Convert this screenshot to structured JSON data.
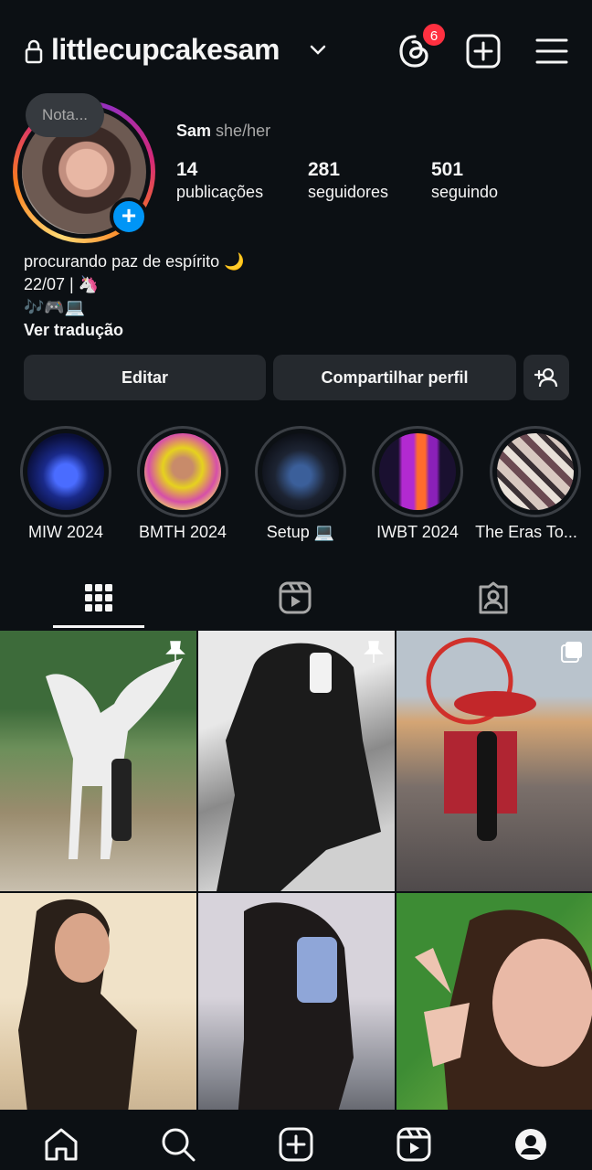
{
  "header": {
    "username": "littlecupcakesam",
    "threads_badge": "6"
  },
  "profile": {
    "note": "Nota...",
    "name": "Sam",
    "pronouns": "she/her",
    "stats": [
      {
        "value": "14",
        "label": "publicações"
      },
      {
        "value": "281",
        "label": "seguidores"
      },
      {
        "value": "501",
        "label": "seguindo"
      }
    ],
    "bio_lines": [
      "procurando paz de espírito 🌙",
      "22/07 | 🦄",
      "🎶🎮💻"
    ],
    "translate": "Ver tradução"
  },
  "buttons": {
    "edit": "Editar",
    "share": "Compartilhar perfil"
  },
  "highlights": [
    {
      "label": "MIW 2024"
    },
    {
      "label": "BMTH 2024"
    },
    {
      "label": "Setup 💻"
    },
    {
      "label": "IWBT 2024"
    },
    {
      "label": "The Eras To..."
    }
  ],
  "tabs": [
    "grid-icon",
    "reels-icon",
    "tagged-icon"
  ],
  "nav": [
    "home-icon",
    "search-icon",
    "create-icon",
    "reels-icon",
    "profile-icon"
  ]
}
